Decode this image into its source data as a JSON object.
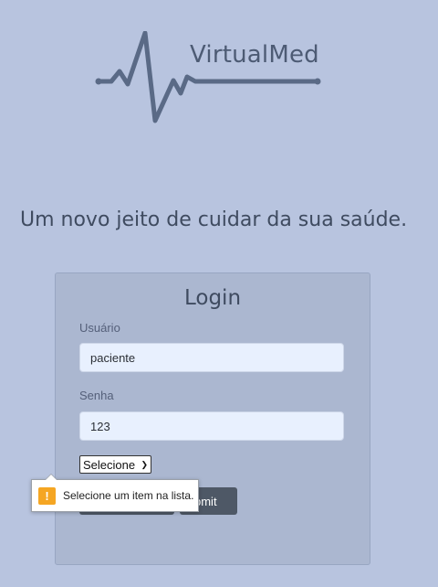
{
  "brand": {
    "name": "VirtualMed",
    "icon": "heartbeat-line-icon"
  },
  "hero": {
    "tagline": "Um novo jeito de cuidar da sua saúde."
  },
  "login": {
    "title": "Login",
    "username_label": "Usuário",
    "username_value": "paciente",
    "password_label": "Senha",
    "password_value": "123",
    "role_select_value": "Selecione",
    "submit_label": "Submit",
    "submit_visible_text": "bmit"
  },
  "validation": {
    "icon": "warning-icon",
    "message": "Selecione um item na lista."
  },
  "colors": {
    "background": "#b8c4df",
    "card": "#abb7d0",
    "button": "#4e5866",
    "logo": "#5a6a86",
    "warning": "#f5a623"
  }
}
